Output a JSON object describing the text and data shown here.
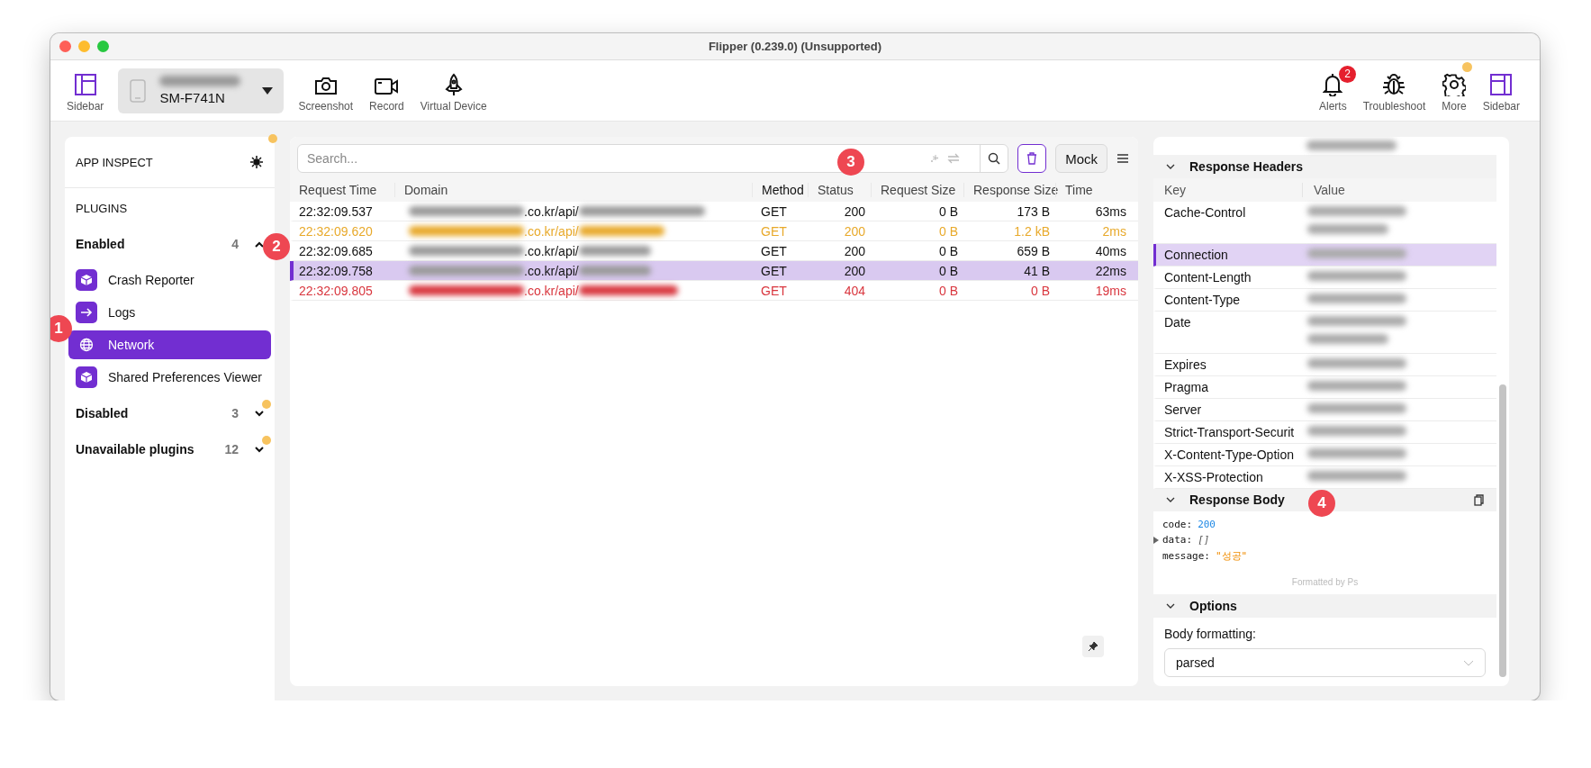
{
  "window": {
    "title": "Flipper (0.239.0) (Unsupported)"
  },
  "toolbar": {
    "left": [
      {
        "kind": "sidebar",
        "label": "Sidebar"
      },
      {
        "kind": "device",
        "label": "SM-F741N"
      },
      {
        "kind": "camera",
        "label": "Screenshot"
      },
      {
        "kind": "video",
        "label": "Record"
      },
      {
        "kind": "rocket",
        "label": "Virtual Device"
      }
    ],
    "right": [
      {
        "kind": "bell",
        "label": "Alerts",
        "badge": "2"
      },
      {
        "kind": "bug",
        "label": "Troubleshoot"
      },
      {
        "kind": "gear",
        "label": "More"
      },
      {
        "kind": "sidebar-right",
        "label": "Sidebar"
      }
    ]
  },
  "sidebar": {
    "header": "APP INSPECT",
    "section": "PLUGINS",
    "groups": [
      {
        "label": "Enabled",
        "count": "4",
        "expanded": true,
        "items": [
          {
            "label": "Crash Reporter",
            "kind": "box",
            "selected": false
          },
          {
            "label": "Logs",
            "kind": "arrow",
            "selected": false
          },
          {
            "label": "Network",
            "kind": "globe",
            "selected": true
          },
          {
            "label": "Shared Preferences Viewer",
            "kind": "box",
            "selected": false
          }
        ]
      },
      {
        "label": "Disabled",
        "count": "3",
        "expanded": false
      },
      {
        "label": "Unavailable plugins",
        "count": "12",
        "expanded": false
      }
    ]
  },
  "network": {
    "search": {
      "placeholder": "Search..."
    },
    "mock_button": "Mock",
    "columns": [
      {
        "label": "Request Time",
        "sorted": false
      },
      {
        "label": "Domain",
        "sorted": false
      },
      {
        "label": "Method",
        "sorted": true
      },
      {
        "label": "Status",
        "sorted": false
      },
      {
        "label": "Request Size",
        "sorted": false
      },
      {
        "label": "Response Size",
        "sorted": false
      },
      {
        "label": "Time",
        "sorted": false
      }
    ],
    "rows": [
      {
        "time": "22:32:09.537",
        "domain": ".co.kr/api/",
        "method": "GET",
        "status": "200",
        "request_size": "0 B",
        "response_size": "173 B",
        "duration": "63ms",
        "kind": "normal",
        "selected": false
      },
      {
        "time": "22:32:09.620",
        "domain": ".co.kr/api/",
        "method": "GET",
        "status": "200",
        "request_size": "0 B",
        "response_size": "1.2 kB",
        "duration": "2ms",
        "kind": "warning",
        "selected": false
      },
      {
        "time": "22:32:09.685",
        "domain": ".co.kr/api/",
        "method": "GET",
        "status": "200",
        "request_size": "0 B",
        "response_size": "659 B",
        "duration": "40ms",
        "kind": "normal",
        "selected": false
      },
      {
        "time": "22:32:09.758",
        "domain": ".co.kr/api/",
        "method": "GET",
        "status": "200",
        "request_size": "0 B",
        "response_size": "41 B",
        "duration": "22ms",
        "kind": "normal",
        "selected": true
      },
      {
        "time": "22:32:09.805",
        "domain": ".co.kr/api/",
        "method": "GET",
        "status": "404",
        "request_size": "0 B",
        "response_size": "0 B",
        "duration": "19ms",
        "kind": "error",
        "selected": false
      }
    ]
  },
  "details": {
    "response_headers": {
      "title": "Response Headers",
      "expanded": true,
      "columns": [
        "Key",
        "Value"
      ],
      "rows": [
        {
          "key": "Cache-Control",
          "wrapped": true,
          "selected": false
        },
        {
          "key": "Connection",
          "wrapped": false,
          "selected": true
        },
        {
          "key": "Content-Length",
          "wrapped": false,
          "selected": false
        },
        {
          "key": "Content-Type",
          "wrapped": false,
          "selected": false
        },
        {
          "key": "Date",
          "wrapped": true,
          "selected": false
        },
        {
          "key": "Expires",
          "wrapped": false,
          "selected": false
        },
        {
          "key": "Pragma",
          "wrapped": false,
          "selected": false
        },
        {
          "key": "Server",
          "wrapped": false,
          "selected": false
        },
        {
          "key": "Strict-Transport-Securit",
          "wrapped": false,
          "selected": false
        },
        {
          "key": "X-Content-Type-Option",
          "wrapped": false,
          "selected": false
        },
        {
          "key": "X-XSS-Protection",
          "wrapped": false,
          "selected": false
        }
      ]
    },
    "response_body": {
      "title": "Response Body",
      "expanded": true,
      "lines": [
        {
          "key": "code:",
          "value": "200",
          "kind": "number",
          "expandable": false
        },
        {
          "key": "data:",
          "value": "[]",
          "kind": "array",
          "expandable": true
        },
        {
          "key": "message:",
          "value": "\"성공\"",
          "kind": "string",
          "expandable": false
        }
      ],
      "footer": "Formatted by Ps"
    },
    "options": {
      "title": "Options",
      "expanded": true,
      "label": "Body formatting:",
      "value": "parsed"
    }
  },
  "annotations": [
    {
      "label": "1"
    },
    {
      "label": "2"
    },
    {
      "label": "3"
    },
    {
      "label": "4"
    }
  ]
}
